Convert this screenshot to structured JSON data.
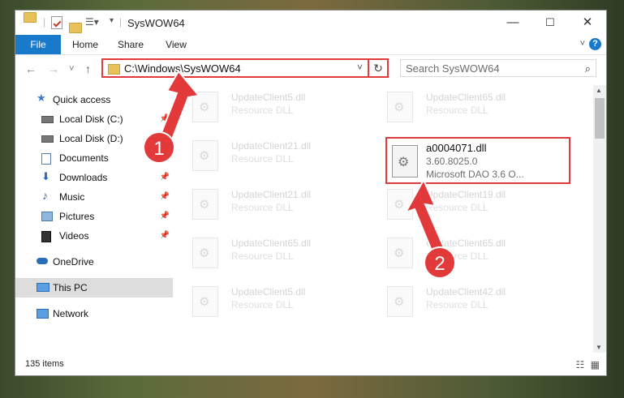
{
  "window": {
    "title": "SysWOW64",
    "minimize_glyph": "—",
    "maximize_glyph": "☐",
    "close_glyph": "✕"
  },
  "ribbon": {
    "tabs": [
      "File",
      "Home",
      "Share",
      "View"
    ]
  },
  "address": {
    "path": "C:\\Windows\\SysWOW64",
    "back_glyph": "←",
    "forward_glyph": "→",
    "recent_glyph": "˅",
    "up_glyph": "↑",
    "refresh_glyph": "↻",
    "dropdown_glyph": "˅"
  },
  "search": {
    "placeholder": "Search SysWOW64",
    "icon": "search-icon"
  },
  "sidebar": {
    "items": [
      {
        "label": "Quick access",
        "icon": "star-icon",
        "pinned": false
      },
      {
        "label": "Local Disk (C:)",
        "icon": "drive-icon",
        "pinned": true
      },
      {
        "label": "Local Disk (D:)",
        "icon": "drive-icon",
        "pinned": false
      },
      {
        "label": "Documents",
        "icon": "documents-icon",
        "pinned": true
      },
      {
        "label": "Downloads",
        "icon": "download-icon",
        "pinned": true
      },
      {
        "label": "Music",
        "icon": "music-icon",
        "pinned": true
      },
      {
        "label": "Pictures",
        "icon": "pictures-icon",
        "pinned": true
      },
      {
        "label": "Videos",
        "icon": "videos-icon",
        "pinned": true
      },
      {
        "label": "OneDrive",
        "icon": "cloud-icon",
        "pinned": false
      },
      {
        "label": "This PC",
        "icon": "computer-icon",
        "pinned": false,
        "selected": true
      },
      {
        "label": "Network",
        "icon": "network-icon",
        "pinned": false
      }
    ]
  },
  "files": [
    {
      "name": "UpdateClient5.dll",
      "desc": "Resource DLL"
    },
    {
      "name": "UpdateClient65.dll",
      "desc": "Resource DLL"
    },
    {
      "name": "UpdateClient21.dll",
      "desc": "Resource DLL"
    },
    {
      "name": "UpdateClient21.dll",
      "desc": "Resource DLL"
    },
    {
      "name": "UpdateClient19.dll",
      "desc": "Resource DLL"
    },
    {
      "name": "UpdateClient65.dll",
      "desc": "Resource DLL"
    },
    {
      "name": "UpdateClient65.dll",
      "desc": "Resource DLL"
    },
    {
      "name": "UpdateClient5.dll",
      "desc": "Resource DLL"
    },
    {
      "name": "UpdateClient42.dll",
      "desc": "Resource DLL"
    }
  ],
  "highlighted_file": {
    "name": "a0004071.dll",
    "version": "3.60.8025.0",
    "desc": "Microsoft DAO 3.6 O..."
  },
  "status": {
    "count": "135 items"
  },
  "annotations": {
    "step1": "1",
    "step2": "2",
    "color": "#e23a3a"
  },
  "colors": {
    "accent": "#1979ca",
    "highlight": "#e23a3a"
  }
}
